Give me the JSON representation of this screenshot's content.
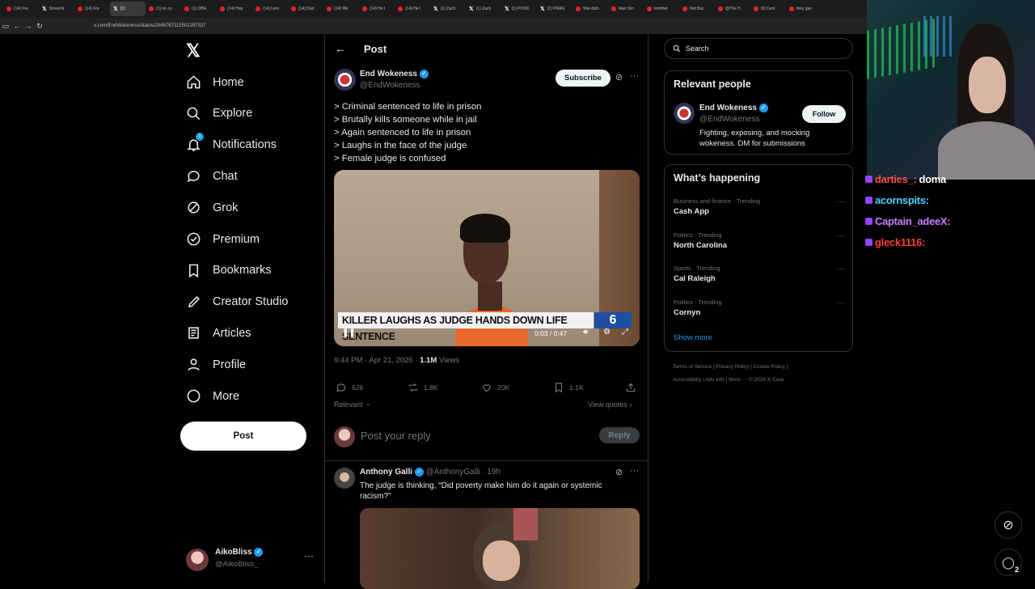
{
  "browser": {
    "tabs": [
      "(14) Fre",
      "Streamli",
      "(14) Fre",
      "(1)",
      "(1) no co",
      "(1) OBA",
      "(14) Hap",
      "(14) Lem",
      "(14) Dad",
      "(14) We",
      "(14) He I",
      "(14) He I",
      "(1) Zach",
      "(1) Zach",
      "(1) POOK",
      "(1) PRAG",
      "She didn",
      "Man Sm",
      "tomthet",
      "Not Buc",
      "@The H",
      "50 Cent",
      "they gav"
    ],
    "url": "x.com/EndWokeness/status/2046767112501297337"
  },
  "nav": {
    "logo": "𝕏",
    "items": [
      "Home",
      "Explore",
      "Notifications",
      "Chat",
      "Grok",
      "Premium",
      "Bookmarks",
      "Creator Studio",
      "Articles",
      "Profile",
      "More"
    ],
    "notif_badge": "1",
    "post_button": "Post",
    "account": {
      "name": "AikoBliss",
      "handle": "@AikoBliss_"
    }
  },
  "main": {
    "header_title": "Post",
    "author": {
      "name": "End Wokeness",
      "handle": "@EndWokeness"
    },
    "subscribe": "Subscribe",
    "lines": [
      "> Criminal sentenced to life in prison",
      "> Brutally kills someone while in jail",
      "> Again sentenced to life in prison",
      "> Laughs in the face of the judge",
      "> Female judge is confused"
    ],
    "video": {
      "chyron": "KILLER LAUGHS AS JUDGE HANDS DOWN LIFE SENTENCE",
      "time": "0:03 / 0:47",
      "channel_number": "6"
    },
    "meta": {
      "time": "9:44 PM · Apr 21, 2026 · ",
      "views_count": "1.1M",
      "views_label": " Views"
    },
    "stats": {
      "replies": "626",
      "reposts": "1.8K",
      "likes": "20K",
      "bookmarks": "1.1K"
    },
    "relevant": "Relevant",
    "view_quotes": "View quotes ›",
    "reply_placeholder": "Post your reply",
    "reply_button": "Reply",
    "reply_tweet": {
      "name": "Anthony Galli",
      "handle": "@AnthonyGalli · 19h",
      "text": "The judge is thinking, “Did poverty make him do it again or systemic racism?”"
    }
  },
  "sidebar": {
    "search_placeholder": "Search",
    "relevant_title": "Relevant people",
    "person": {
      "name": "End Wokeness",
      "handle": "@EndWokeness",
      "bio": "Fighting, exposing, and mocking wokeness. DM for submissions",
      "follow": "Follow"
    },
    "happening_title": "What’s happening",
    "trends": [
      {
        "cat": "Business and finance · Trending",
        "name": "Cash App"
      },
      {
        "cat": "Politics · Trending",
        "name": "North Carolina"
      },
      {
        "cat": "Sports · Trending",
        "name": "Cal Raleigh"
      },
      {
        "cat": "Politics · Trending",
        "name": "Cornyn"
      }
    ],
    "show_more": "Show more",
    "footer_row1": "Terms of Service  |  Privacy Policy  |  Cookie Policy  |",
    "footer_row2": "Accessibility  |  Ads info  |  More ···  © 2026 X Corp."
  },
  "overlay": {
    "chat": [
      {
        "user": "darties_:",
        "msg": "doma",
        "color": "#ff4d4d"
      },
      {
        "user": "acornspits:",
        "msg": "",
        "color": "#4dd2ff"
      },
      {
        "user": "Captain_adeeX:",
        "msg": "",
        "color": "#c77dff"
      },
      {
        "user": "gleck1116:",
        "msg": "",
        "color": "#ff3b3b"
      }
    ],
    "notif_count": "2"
  }
}
